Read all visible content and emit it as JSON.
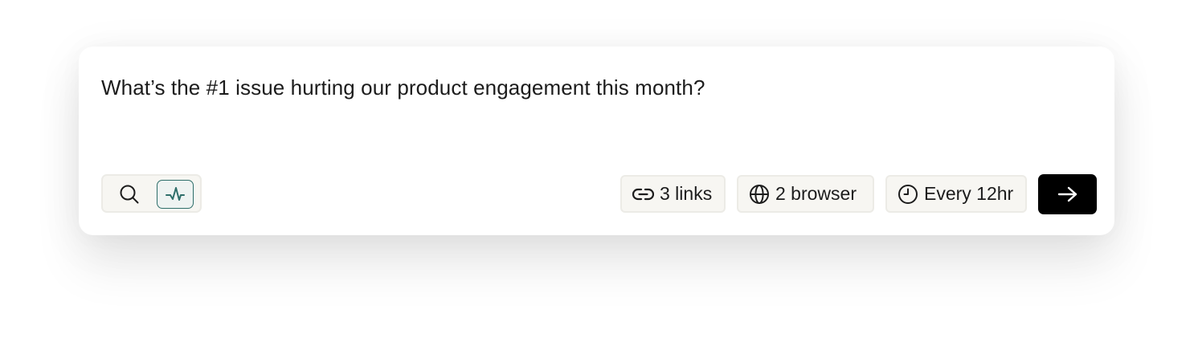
{
  "prompt": {
    "text": "What’s the #1 issue hurting our product engagement this month?"
  },
  "mode_toggle": {
    "options": [
      {
        "icon": "search-icon",
        "selected": false
      },
      {
        "icon": "pulse-icon",
        "selected": true
      }
    ],
    "accent_color": "#2e6e6a"
  },
  "chips": {
    "links": {
      "icon": "link-icon",
      "label": "3 links"
    },
    "browser": {
      "icon": "globe-icon",
      "label": "2 browser"
    },
    "schedule": {
      "icon": "clock-icon",
      "label": "Every 12hr"
    }
  },
  "submit": {
    "icon": "arrow-right-icon",
    "background": "#000000"
  }
}
